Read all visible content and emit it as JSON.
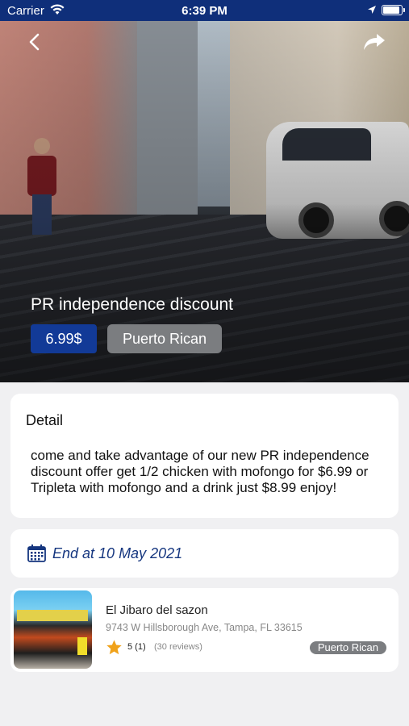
{
  "status_bar": {
    "carrier": "Carrier",
    "time": "6:39 PM"
  },
  "deal": {
    "title": "PR independence discount",
    "price": "6.99$",
    "category": "Puerto Rican"
  },
  "detail": {
    "heading": "Detail",
    "text": "come and take advantage of our new PR independence discount offer get 1/2 chicken with mofongo for $6.99 or Tripleta with mofongo and a drink just $8.99 enjoy!"
  },
  "end_date": {
    "text": "End at 10 May 2021"
  },
  "restaurant": {
    "name": "El Jibaro del sazon",
    "address": "9743 W Hillsborough Ave, Tampa, FL 33615",
    "rating": "5 (1)",
    "reviews": "(30 reviews)",
    "category": "Puerto Rican"
  },
  "colors": {
    "header_blue": "#0f2f7a",
    "price_badge": "#123a97",
    "category_badge": "#7b7d80",
    "date_text": "#15367f",
    "star": "#f0a21a"
  },
  "icons": [
    "back-arrow-icon",
    "share-icon",
    "wifi-icon",
    "location-arrow-icon",
    "battery-icon",
    "calendar-icon",
    "star-icon"
  ]
}
